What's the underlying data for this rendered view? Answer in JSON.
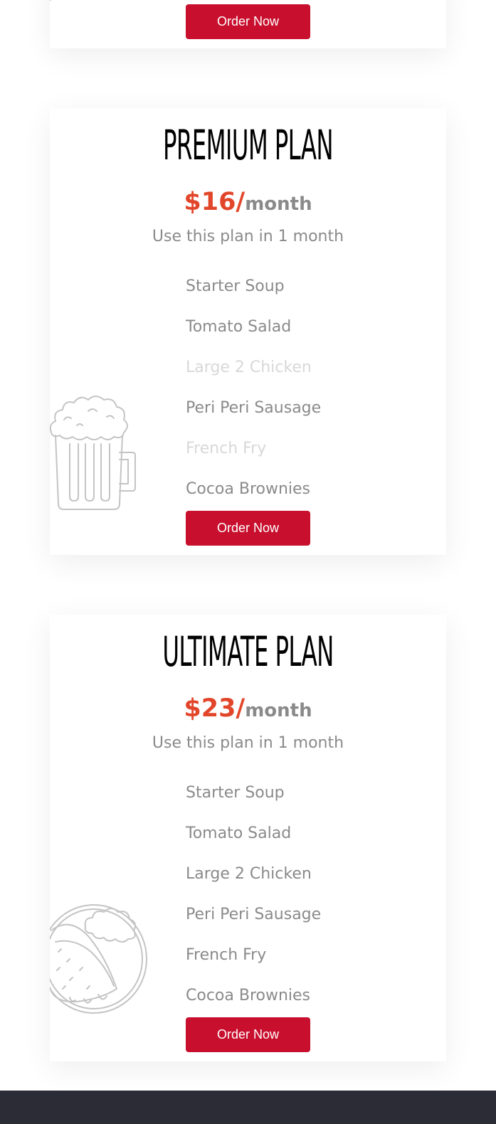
{
  "top_card": {
    "order_label": "Order Now"
  },
  "plans": [
    {
      "title": "PREMIUM PLAN",
      "price": "$16/",
      "per": "month",
      "duration": "Use this plan in 1 month",
      "features": [
        {
          "label": "Starter Soup",
          "available": true
        },
        {
          "label": "Tomato Salad",
          "available": true
        },
        {
          "label": "Large 2 Chicken",
          "available": false
        },
        {
          "label": "Peri Peri Sausage",
          "available": true
        },
        {
          "label": "French Fry",
          "available": false
        },
        {
          "label": "Cocoa Brownies",
          "available": true
        }
      ],
      "order_label": "Order Now",
      "illustration": "beer-mug-icon"
    },
    {
      "title": "ULTIMATE PLAN",
      "price": "$23/",
      "per": "month",
      "duration": "Use this plan in 1 month",
      "features": [
        {
          "label": "Starter Soup",
          "available": true
        },
        {
          "label": "Tomato Salad",
          "available": true
        },
        {
          "label": "Large 2 Chicken",
          "available": true
        },
        {
          "label": "Peri Peri Sausage",
          "available": true
        },
        {
          "label": "French Fry",
          "available": true
        },
        {
          "label": "Cocoa Brownies",
          "available": true
        }
      ],
      "order_label": "Order Now",
      "illustration": "taco-plate-icon"
    }
  ],
  "colors": {
    "accent": "#c8102e",
    "price": "#e2462a",
    "text_muted": "#8a8a8a",
    "text_disabled": "#d8d8d8",
    "footer": "#2b2c35"
  }
}
